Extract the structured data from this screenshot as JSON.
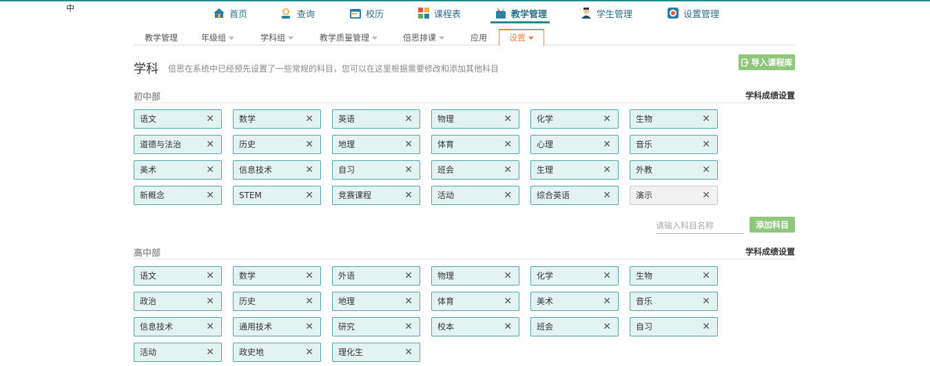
{
  "lang": "中",
  "nav": [
    {
      "label": "首页",
      "icon": "home-icon"
    },
    {
      "label": "查询",
      "icon": "search-person-icon"
    },
    {
      "label": "校历",
      "icon": "calendar-icon"
    },
    {
      "label": "课程表",
      "icon": "timetable-icon"
    },
    {
      "label": "教学管理",
      "icon": "teaching-icon",
      "active": true
    },
    {
      "label": "学生管理",
      "icon": "student-icon"
    },
    {
      "label": "设置管理",
      "icon": "settings-icon"
    }
  ],
  "subnav": [
    {
      "label": "教学管理",
      "caret": false
    },
    {
      "label": "年级组",
      "caret": true
    },
    {
      "label": "学科组",
      "caret": true
    },
    {
      "label": "教学质量管理",
      "caret": true
    },
    {
      "label": "倍思排课",
      "caret": true
    },
    {
      "label": "应用",
      "caret": false
    },
    {
      "label": "设置",
      "caret": true,
      "active": true
    }
  ],
  "page": {
    "title": "学科",
    "desc": "倍思在系统中已经预先设置了一些常规的科目，您可以在这里根据需要修改和添加其他科目",
    "import_label": "导入课程库"
  },
  "junior": {
    "title": "初中部",
    "link": "学科成绩设置",
    "subjects": [
      "语文",
      "数学",
      "英语",
      "物理",
      "化学",
      "生物",
      "道德与法治",
      "历史",
      "地理",
      "体育",
      "心理",
      "音乐",
      "美术",
      "信息技术",
      "自习",
      "班会",
      "生理",
      "外教",
      "新概念",
      "STEM",
      "竞赛课程",
      "活动",
      "综合英语",
      "演示"
    ],
    "plain_index": 23,
    "input_placeholder": "请输入科目名称",
    "add_label": "添加科目"
  },
  "senior": {
    "title": "高中部",
    "link": "学科成绩设置",
    "subjects": [
      "语文",
      "数学",
      "外语",
      "物理",
      "化学",
      "生物",
      "政治",
      "历史",
      "地理",
      "体育",
      "美术",
      "音乐",
      "信息技术",
      "通用技术",
      "研究",
      "校本",
      "班会",
      "自习",
      "活动",
      "政史地",
      "理化生"
    ]
  },
  "colors": {
    "accent": "#1d8a88",
    "active_tab": "#e2874a",
    "green_button": "#8fc77c",
    "tag_bg": "#e3f3f2",
    "tag_border": "#4aa3a8"
  }
}
